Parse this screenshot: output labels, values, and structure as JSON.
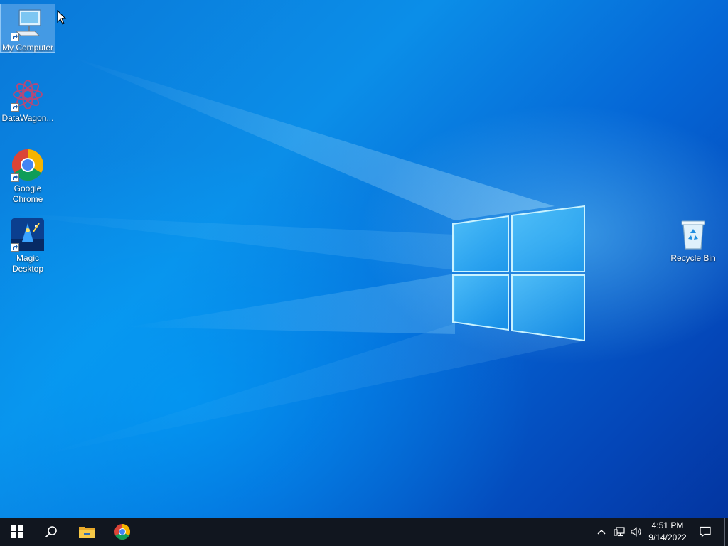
{
  "desktop": {
    "icons": [
      {
        "label": "My Computer",
        "icon": "monitor-icon"
      },
      {
        "label": "DataWagon...",
        "icon": "datawagon-icon"
      },
      {
        "label": "Google Chrome",
        "icon": "chrome-icon"
      },
      {
        "label": "Magic Desktop",
        "icon": "magic-desktop-icon"
      },
      {
        "label": "Recycle Bin",
        "icon": "recycle-bin-icon"
      }
    ],
    "colors": {
      "background": "#0a78d8",
      "logo_glow": "#8fe4ff"
    }
  },
  "taskbar": {
    "pinned": [
      {
        "name": "Start",
        "icon": "windows-start-icon"
      },
      {
        "name": "Search",
        "icon": "search-icon"
      },
      {
        "name": "File Explorer",
        "icon": "folder-icon"
      },
      {
        "name": "Google Chrome",
        "icon": "chrome-icon"
      }
    ],
    "tray": {
      "icons": [
        "chevron-up-icon",
        "network-icon",
        "volume-icon",
        "notification-icon"
      ],
      "time": "4:51 PM",
      "date": "9/14/2022"
    },
    "colors": {
      "background": "#11161f"
    }
  }
}
